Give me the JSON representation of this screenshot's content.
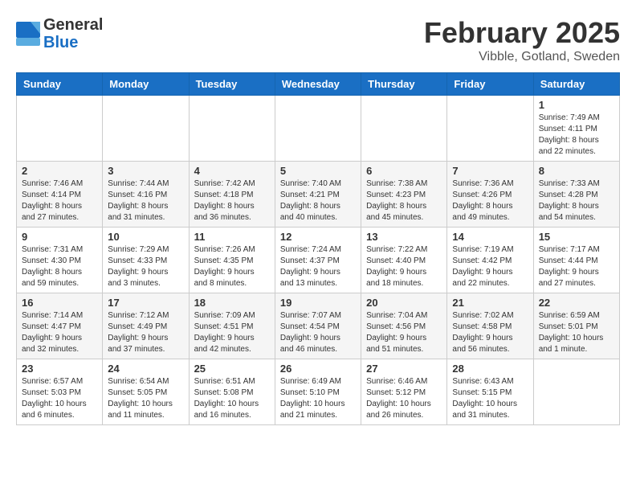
{
  "logo": {
    "general": "General",
    "blue": "Blue"
  },
  "title": {
    "month": "February 2025",
    "location": "Vibble, Gotland, Sweden"
  },
  "weekdays": [
    "Sunday",
    "Monday",
    "Tuesday",
    "Wednesday",
    "Thursday",
    "Friday",
    "Saturday"
  ],
  "weeks": [
    [
      {
        "day": "",
        "info": ""
      },
      {
        "day": "",
        "info": ""
      },
      {
        "day": "",
        "info": ""
      },
      {
        "day": "",
        "info": ""
      },
      {
        "day": "",
        "info": ""
      },
      {
        "day": "",
        "info": ""
      },
      {
        "day": "1",
        "info": "Sunrise: 7:49 AM\nSunset: 4:11 PM\nDaylight: 8 hours and 22 minutes."
      }
    ],
    [
      {
        "day": "2",
        "info": "Sunrise: 7:46 AM\nSunset: 4:14 PM\nDaylight: 8 hours and 27 minutes."
      },
      {
        "day": "3",
        "info": "Sunrise: 7:44 AM\nSunset: 4:16 PM\nDaylight: 8 hours and 31 minutes."
      },
      {
        "day": "4",
        "info": "Sunrise: 7:42 AM\nSunset: 4:18 PM\nDaylight: 8 hours and 36 minutes."
      },
      {
        "day": "5",
        "info": "Sunrise: 7:40 AM\nSunset: 4:21 PM\nDaylight: 8 hours and 40 minutes."
      },
      {
        "day": "6",
        "info": "Sunrise: 7:38 AM\nSunset: 4:23 PM\nDaylight: 8 hours and 45 minutes."
      },
      {
        "day": "7",
        "info": "Sunrise: 7:36 AM\nSunset: 4:26 PM\nDaylight: 8 hours and 49 minutes."
      },
      {
        "day": "8",
        "info": "Sunrise: 7:33 AM\nSunset: 4:28 PM\nDaylight: 8 hours and 54 minutes."
      }
    ],
    [
      {
        "day": "9",
        "info": "Sunrise: 7:31 AM\nSunset: 4:30 PM\nDaylight: 8 hours and 59 minutes."
      },
      {
        "day": "10",
        "info": "Sunrise: 7:29 AM\nSunset: 4:33 PM\nDaylight: 9 hours and 3 minutes."
      },
      {
        "day": "11",
        "info": "Sunrise: 7:26 AM\nSunset: 4:35 PM\nDaylight: 9 hours and 8 minutes."
      },
      {
        "day": "12",
        "info": "Sunrise: 7:24 AM\nSunset: 4:37 PM\nDaylight: 9 hours and 13 minutes."
      },
      {
        "day": "13",
        "info": "Sunrise: 7:22 AM\nSunset: 4:40 PM\nDaylight: 9 hours and 18 minutes."
      },
      {
        "day": "14",
        "info": "Sunrise: 7:19 AM\nSunset: 4:42 PM\nDaylight: 9 hours and 22 minutes."
      },
      {
        "day": "15",
        "info": "Sunrise: 7:17 AM\nSunset: 4:44 PM\nDaylight: 9 hours and 27 minutes."
      }
    ],
    [
      {
        "day": "16",
        "info": "Sunrise: 7:14 AM\nSunset: 4:47 PM\nDaylight: 9 hours and 32 minutes."
      },
      {
        "day": "17",
        "info": "Sunrise: 7:12 AM\nSunset: 4:49 PM\nDaylight: 9 hours and 37 minutes."
      },
      {
        "day": "18",
        "info": "Sunrise: 7:09 AM\nSunset: 4:51 PM\nDaylight: 9 hours and 42 minutes."
      },
      {
        "day": "19",
        "info": "Sunrise: 7:07 AM\nSunset: 4:54 PM\nDaylight: 9 hours and 46 minutes."
      },
      {
        "day": "20",
        "info": "Sunrise: 7:04 AM\nSunset: 4:56 PM\nDaylight: 9 hours and 51 minutes."
      },
      {
        "day": "21",
        "info": "Sunrise: 7:02 AM\nSunset: 4:58 PM\nDaylight: 9 hours and 56 minutes."
      },
      {
        "day": "22",
        "info": "Sunrise: 6:59 AM\nSunset: 5:01 PM\nDaylight: 10 hours and 1 minute."
      }
    ],
    [
      {
        "day": "23",
        "info": "Sunrise: 6:57 AM\nSunset: 5:03 PM\nDaylight: 10 hours and 6 minutes."
      },
      {
        "day": "24",
        "info": "Sunrise: 6:54 AM\nSunset: 5:05 PM\nDaylight: 10 hours and 11 minutes."
      },
      {
        "day": "25",
        "info": "Sunrise: 6:51 AM\nSunset: 5:08 PM\nDaylight: 10 hours and 16 minutes."
      },
      {
        "day": "26",
        "info": "Sunrise: 6:49 AM\nSunset: 5:10 PM\nDaylight: 10 hours and 21 minutes."
      },
      {
        "day": "27",
        "info": "Sunrise: 6:46 AM\nSunset: 5:12 PM\nDaylight: 10 hours and 26 minutes."
      },
      {
        "day": "28",
        "info": "Sunrise: 6:43 AM\nSunset: 5:15 PM\nDaylight: 10 hours and 31 minutes."
      },
      {
        "day": "",
        "info": ""
      }
    ]
  ]
}
